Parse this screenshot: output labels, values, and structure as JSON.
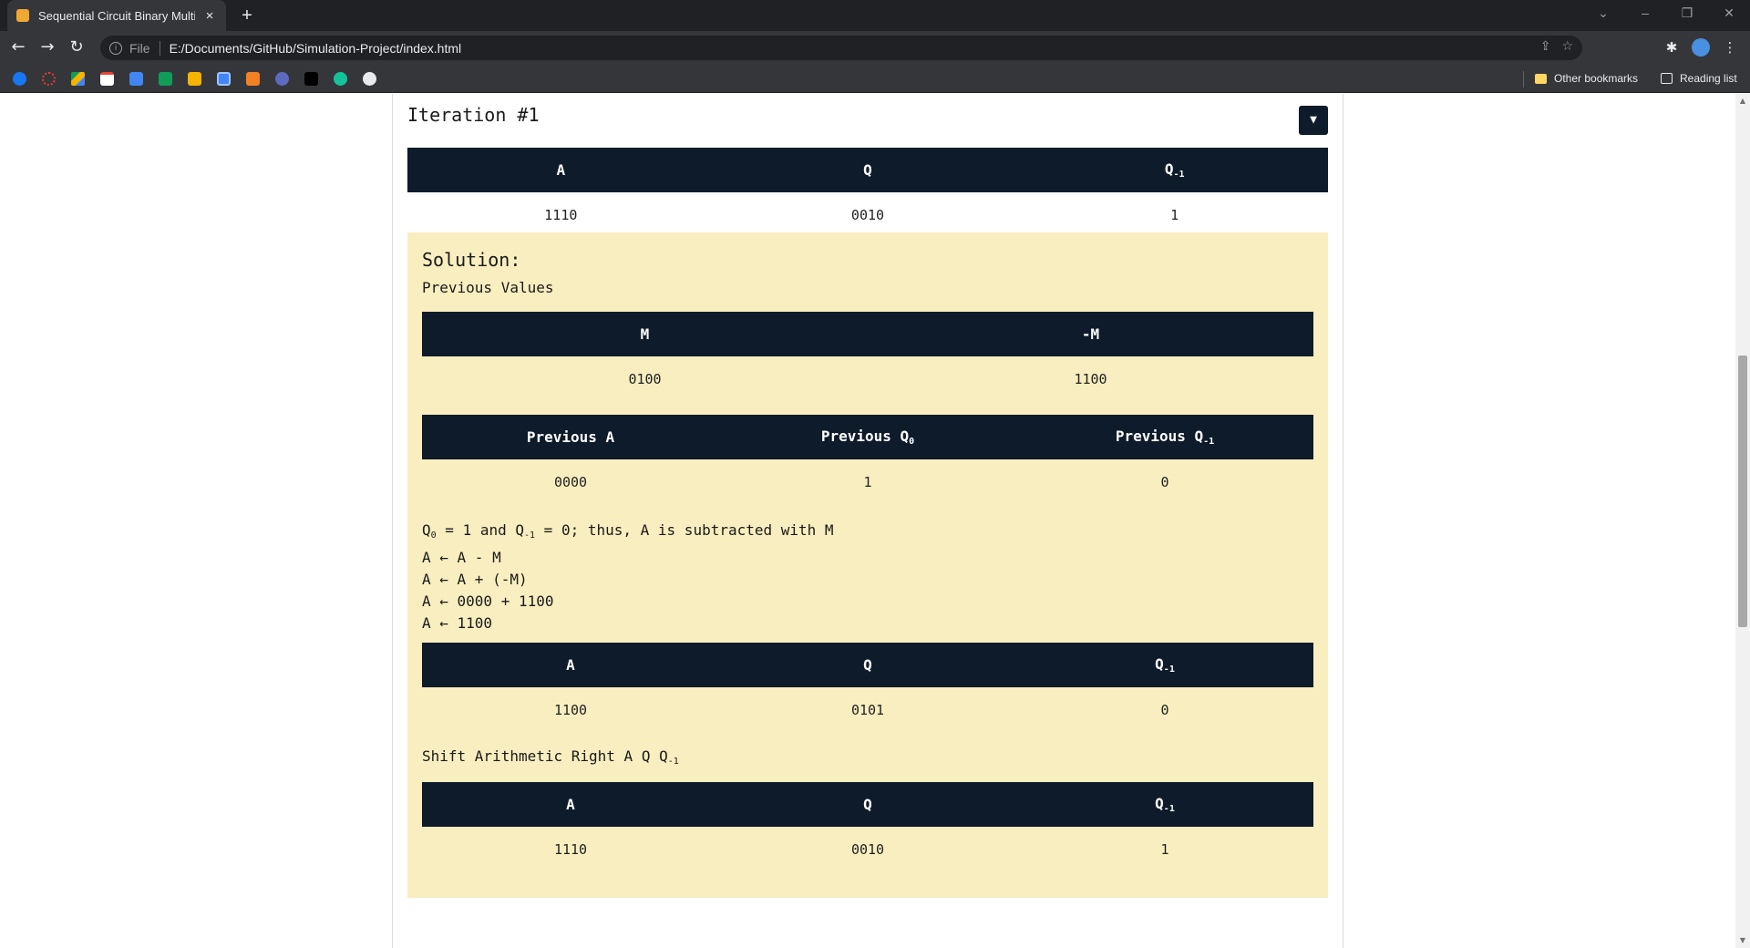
{
  "browser": {
    "tab_title": "Sequential Circuit Binary Multiplic",
    "tab_close": "×",
    "new_tab": "+",
    "url_scheme": "File",
    "url": "E:/Documents/GitHub/Simulation-Project/index.html",
    "bookmarks_folder": "Other bookmarks",
    "reading_list": "Reading list"
  },
  "page": {
    "iteration_title": "Iteration #1",
    "result_table": {
      "headers": [
        "A",
        "Q",
        "Q",
        "-1"
      ],
      "row": [
        "1110",
        "0010",
        "1"
      ]
    },
    "solution": {
      "title": "Solution:",
      "previous_values_label": "Previous Values",
      "m_table": {
        "headers": [
          "M",
          "-M"
        ],
        "row": [
          "0100",
          "1100"
        ]
      },
      "prev_table": {
        "h1": "Previous A",
        "h2": "Previous Q",
        "h2_sub": "0",
        "h3": "Previous Q",
        "h3_sub": "-1",
        "row": [
          "0000",
          "1",
          "0"
        ]
      },
      "explanation": {
        "l1_a": "Q",
        "l1_a_sub": "0",
        "l1_b": " = 1 and Q",
        "l1_b_sub": "-1",
        "l1_c": " = 0; thus, A is subtracted with M",
        "l2": "A ← A - M",
        "l3": "A ← A + (-M)",
        "l4": "A ← 0000 + 1100",
        "l5": "A ← 1100"
      },
      "after_table": {
        "headers": [
          "A",
          "Q",
          "Q",
          "-1"
        ],
        "row": [
          "1100",
          "0101",
          "0"
        ]
      },
      "shift_label": "Shift Arithmetic Right A Q Q",
      "shift_label_sub": "-1",
      "shift_table": {
        "headers": [
          "A",
          "Q",
          "Q",
          "-1"
        ],
        "row": [
          "1110",
          "0010",
          "1"
        ]
      }
    }
  }
}
